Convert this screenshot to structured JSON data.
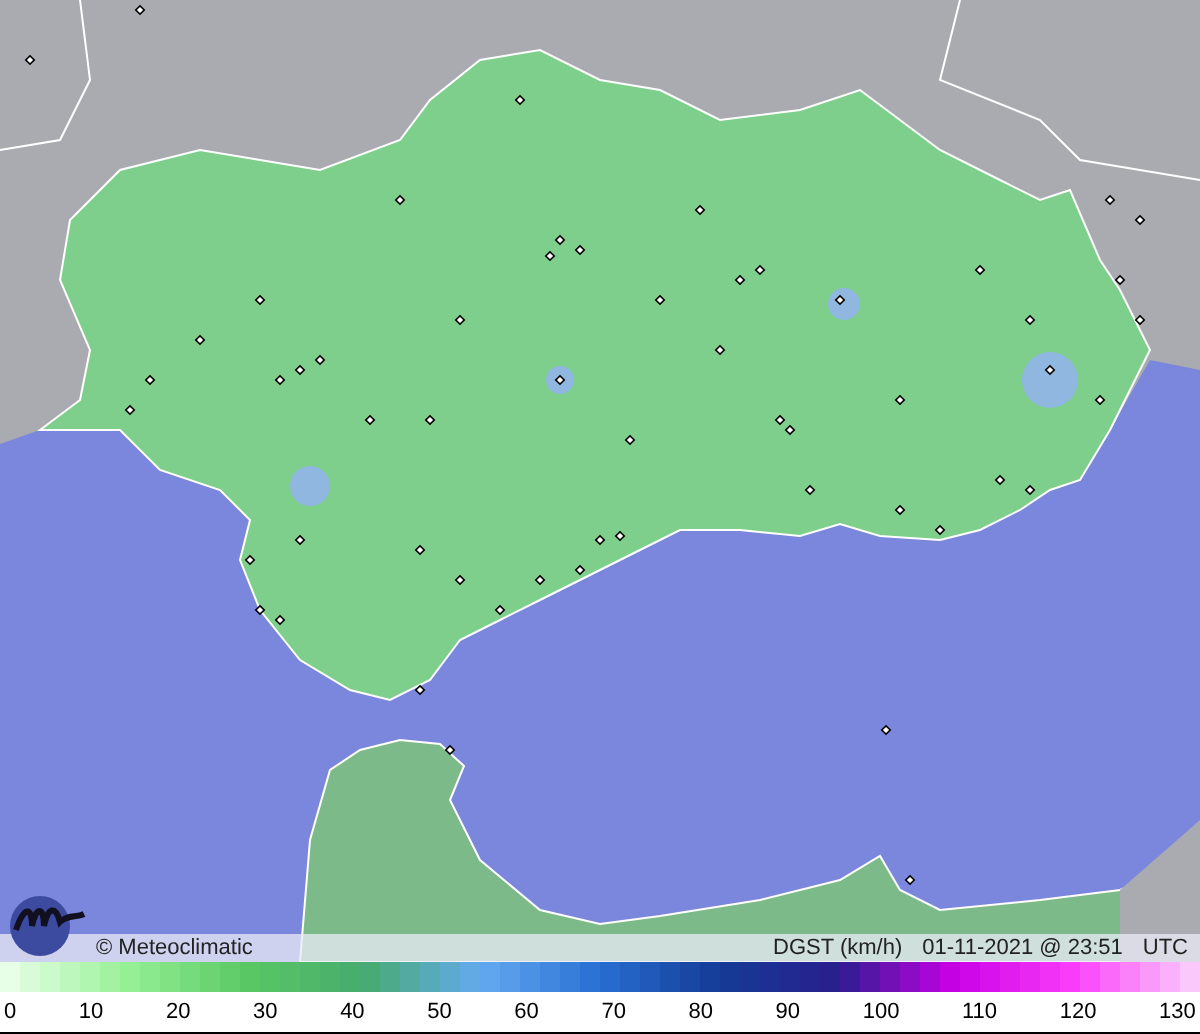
{
  "map": {
    "copyright": "© Meteoclimatic",
    "caption": [
      "DGST (km/h)",
      "01-11-2021 @ 23:51",
      "UTC"
    ]
  },
  "legend": {
    "ticks": [
      "0",
      "10",
      "20",
      "30",
      "40",
      "50",
      "60",
      "70",
      "80",
      "90",
      "100",
      "110",
      "120",
      "130"
    ]
  }
}
